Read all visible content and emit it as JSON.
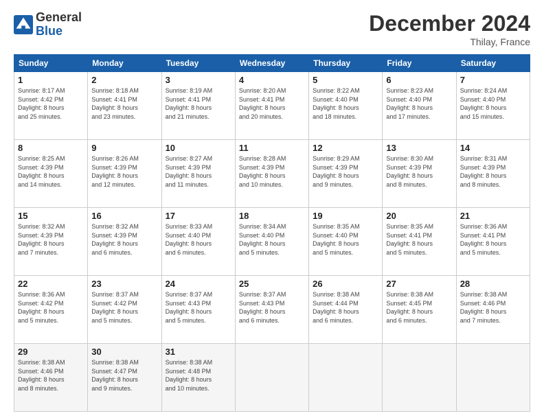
{
  "header": {
    "logo_line1": "General",
    "logo_line2": "Blue",
    "month": "December 2024",
    "location": "Thilay, France"
  },
  "weekdays": [
    "Sunday",
    "Monday",
    "Tuesday",
    "Wednesday",
    "Thursday",
    "Friday",
    "Saturday"
  ],
  "weeks": [
    [
      {
        "day": "1",
        "info": "Sunrise: 8:17 AM\nSunset: 4:42 PM\nDaylight: 8 hours\nand 25 minutes."
      },
      {
        "day": "2",
        "info": "Sunrise: 8:18 AM\nSunset: 4:41 PM\nDaylight: 8 hours\nand 23 minutes."
      },
      {
        "day": "3",
        "info": "Sunrise: 8:19 AM\nSunset: 4:41 PM\nDaylight: 8 hours\nand 21 minutes."
      },
      {
        "day": "4",
        "info": "Sunrise: 8:20 AM\nSunset: 4:41 PM\nDaylight: 8 hours\nand 20 minutes."
      },
      {
        "day": "5",
        "info": "Sunrise: 8:22 AM\nSunset: 4:40 PM\nDaylight: 8 hours\nand 18 minutes."
      },
      {
        "day": "6",
        "info": "Sunrise: 8:23 AM\nSunset: 4:40 PM\nDaylight: 8 hours\nand 17 minutes."
      },
      {
        "day": "7",
        "info": "Sunrise: 8:24 AM\nSunset: 4:40 PM\nDaylight: 8 hours\nand 15 minutes."
      }
    ],
    [
      {
        "day": "8",
        "info": "Sunrise: 8:25 AM\nSunset: 4:39 PM\nDaylight: 8 hours\nand 14 minutes."
      },
      {
        "day": "9",
        "info": "Sunrise: 8:26 AM\nSunset: 4:39 PM\nDaylight: 8 hours\nand 12 minutes."
      },
      {
        "day": "10",
        "info": "Sunrise: 8:27 AM\nSunset: 4:39 PM\nDaylight: 8 hours\nand 11 minutes."
      },
      {
        "day": "11",
        "info": "Sunrise: 8:28 AM\nSunset: 4:39 PM\nDaylight: 8 hours\nand 10 minutes."
      },
      {
        "day": "12",
        "info": "Sunrise: 8:29 AM\nSunset: 4:39 PM\nDaylight: 8 hours\nand 9 minutes."
      },
      {
        "day": "13",
        "info": "Sunrise: 8:30 AM\nSunset: 4:39 PM\nDaylight: 8 hours\nand 8 minutes."
      },
      {
        "day": "14",
        "info": "Sunrise: 8:31 AM\nSunset: 4:39 PM\nDaylight: 8 hours\nand 8 minutes."
      }
    ],
    [
      {
        "day": "15",
        "info": "Sunrise: 8:32 AM\nSunset: 4:39 PM\nDaylight: 8 hours\nand 7 minutes."
      },
      {
        "day": "16",
        "info": "Sunrise: 8:32 AM\nSunset: 4:39 PM\nDaylight: 8 hours\nand 6 minutes."
      },
      {
        "day": "17",
        "info": "Sunrise: 8:33 AM\nSunset: 4:40 PM\nDaylight: 8 hours\nand 6 minutes."
      },
      {
        "day": "18",
        "info": "Sunrise: 8:34 AM\nSunset: 4:40 PM\nDaylight: 8 hours\nand 5 minutes."
      },
      {
        "day": "19",
        "info": "Sunrise: 8:35 AM\nSunset: 4:40 PM\nDaylight: 8 hours\nand 5 minutes."
      },
      {
        "day": "20",
        "info": "Sunrise: 8:35 AM\nSunset: 4:41 PM\nDaylight: 8 hours\nand 5 minutes."
      },
      {
        "day": "21",
        "info": "Sunrise: 8:36 AM\nSunset: 4:41 PM\nDaylight: 8 hours\nand 5 minutes."
      }
    ],
    [
      {
        "day": "22",
        "info": "Sunrise: 8:36 AM\nSunset: 4:42 PM\nDaylight: 8 hours\nand 5 minutes."
      },
      {
        "day": "23",
        "info": "Sunrise: 8:37 AM\nSunset: 4:42 PM\nDaylight: 8 hours\nand 5 minutes."
      },
      {
        "day": "24",
        "info": "Sunrise: 8:37 AM\nSunset: 4:43 PM\nDaylight: 8 hours\nand 5 minutes."
      },
      {
        "day": "25",
        "info": "Sunrise: 8:37 AM\nSunset: 4:43 PM\nDaylight: 8 hours\nand 6 minutes."
      },
      {
        "day": "26",
        "info": "Sunrise: 8:38 AM\nSunset: 4:44 PM\nDaylight: 8 hours\nand 6 minutes."
      },
      {
        "day": "27",
        "info": "Sunrise: 8:38 AM\nSunset: 4:45 PM\nDaylight: 8 hours\nand 6 minutes."
      },
      {
        "day": "28",
        "info": "Sunrise: 8:38 AM\nSunset: 4:46 PM\nDaylight: 8 hours\nand 7 minutes."
      }
    ],
    [
      {
        "day": "29",
        "info": "Sunrise: 8:38 AM\nSunset: 4:46 PM\nDaylight: 8 hours\nand 8 minutes."
      },
      {
        "day": "30",
        "info": "Sunrise: 8:38 AM\nSunset: 4:47 PM\nDaylight: 8 hours\nand 9 minutes."
      },
      {
        "day": "31",
        "info": "Sunrise: 8:38 AM\nSunset: 4:48 PM\nDaylight: 8 hours\nand 10 minutes."
      },
      {
        "day": "",
        "info": ""
      },
      {
        "day": "",
        "info": ""
      },
      {
        "day": "",
        "info": ""
      },
      {
        "day": "",
        "info": ""
      }
    ]
  ]
}
